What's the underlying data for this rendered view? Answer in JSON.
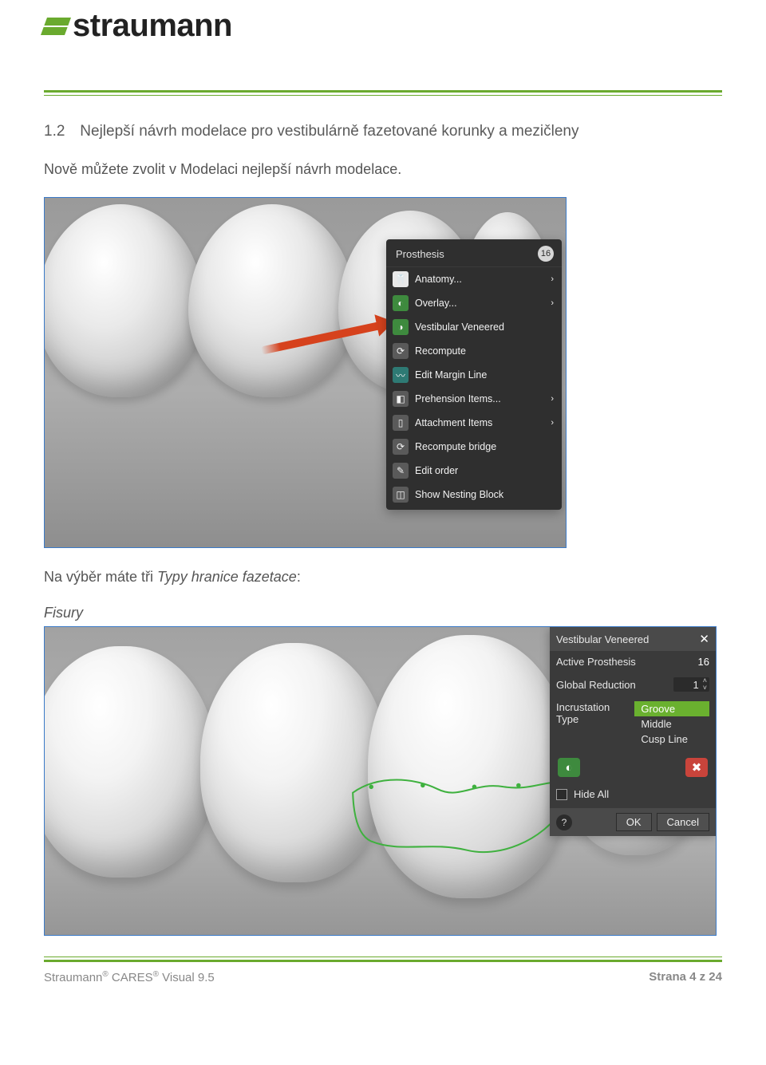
{
  "brand": {
    "name": "straumann"
  },
  "section": {
    "number": "1.2",
    "title": "Nejlepší návrh modelace pro vestibulárně fazetované korunky a mezičleny"
  },
  "body": {
    "intro": "Nově můžete zvolit v Modelaci nejlepší návrh modelace.",
    "choices_prefix": "Na výběr máte tři ",
    "choices_italic": "Typy hranice fazetace",
    "choices_suffix": ":",
    "subheading": "Fisury"
  },
  "contextMenu": {
    "title": "Prosthesis",
    "badge": "16",
    "items": [
      {
        "label": "Anatomy...",
        "arrow": true
      },
      {
        "label": "Overlay...",
        "arrow": true
      },
      {
        "label": "Vestibular Veneered",
        "arrow": false
      },
      {
        "label": "Recompute",
        "arrow": false
      },
      {
        "label": "Edit Margin Line",
        "arrow": false
      },
      {
        "label": "Prehension Items...",
        "arrow": true
      },
      {
        "label": "Attachment Items",
        "arrow": true
      },
      {
        "label": "Recompute bridge",
        "arrow": false
      },
      {
        "label": "Edit order",
        "arrow": false
      },
      {
        "label": "Show Nesting Block",
        "arrow": false
      }
    ]
  },
  "panel": {
    "title": "Vestibular Veneered",
    "activeLabel": "Active Prosthesis",
    "activeValue": "16",
    "globalReductionLabel": "Global Reduction",
    "globalReductionValue": "1",
    "incrustationLabel": "Incrustation Type",
    "options": [
      "Groove",
      "Middle",
      "Cusp Line"
    ],
    "selectedOption": "Groove",
    "hideLabel": "Hide All",
    "ok": "OK",
    "cancel": "Cancel"
  },
  "footer": {
    "product": "Straumann",
    "reg1": "®",
    "cares": " CARES",
    "reg2": "®",
    "version": " Visual 9.5",
    "page": "Strana 4 z 24"
  }
}
